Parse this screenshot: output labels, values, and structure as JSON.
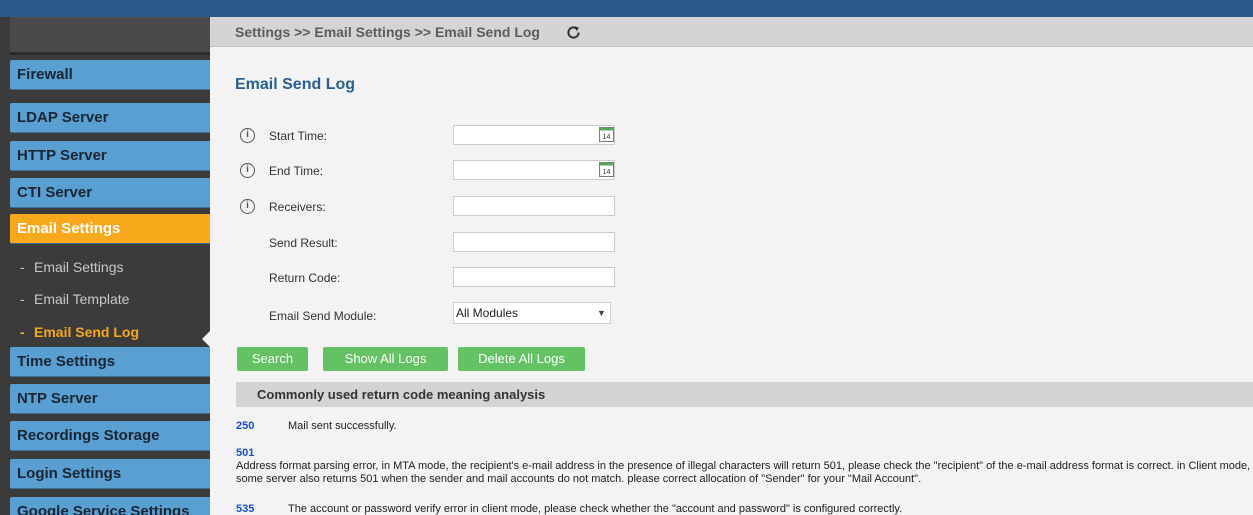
{
  "breadcrumb": "Settings >> Email Settings >> Email Send Log",
  "page_title": "Email Send Log",
  "sidebar": {
    "items": [
      {
        "label": "Firewall"
      },
      {
        "label": "LDAP Server"
      },
      {
        "label": "HTTP Server"
      },
      {
        "label": "CTI Server"
      },
      {
        "label": "Email Settings"
      },
      {
        "label": "Time Settings"
      },
      {
        "label": "NTP Server"
      },
      {
        "label": "Recordings Storage"
      },
      {
        "label": "Login Settings"
      },
      {
        "label": "Google Service Settings"
      }
    ],
    "subitems": [
      {
        "label": "Email Settings"
      },
      {
        "label": "Email Template"
      },
      {
        "label": "Email Send Log"
      }
    ],
    "active_color": "#f7a81b",
    "item_color": "#5a9fd1"
  },
  "form": {
    "start_time": {
      "label": "Start Time:",
      "value": ""
    },
    "end_time": {
      "label": "End Time:",
      "value": ""
    },
    "receivers": {
      "label": "Receivers:",
      "value": ""
    },
    "send_result": {
      "label": "Send Result:",
      "value": ""
    },
    "return_code": {
      "label": "Return Code:",
      "value": ""
    },
    "module": {
      "label": "Email Send Module:",
      "value": "All Modules"
    },
    "calendar_day": "14"
  },
  "buttons": {
    "search": "Search",
    "show_all": "Show All Logs",
    "delete_all": "Delete All Logs"
  },
  "codes_section": {
    "title": "Commonly used return code meaning analysis",
    "codes": [
      {
        "code": "250",
        "desc": "Mail sent successfully."
      },
      {
        "code": "501",
        "desc": "Address format parsing error, in MTA mode, the recipient's e-mail address in the presence of illegal characters will return 501, please check the \"recipient\" of the e-mail address format is correct. in Client mode, some server also returns 501 when the sender and mail accounts do not match. please correct allocation of \"Sender\" for your \"Mail Account\"."
      },
      {
        "code": "535",
        "desc": "The account or password verify error in client mode, please check whether the \"account and password\" is configured correctly."
      }
    ]
  }
}
